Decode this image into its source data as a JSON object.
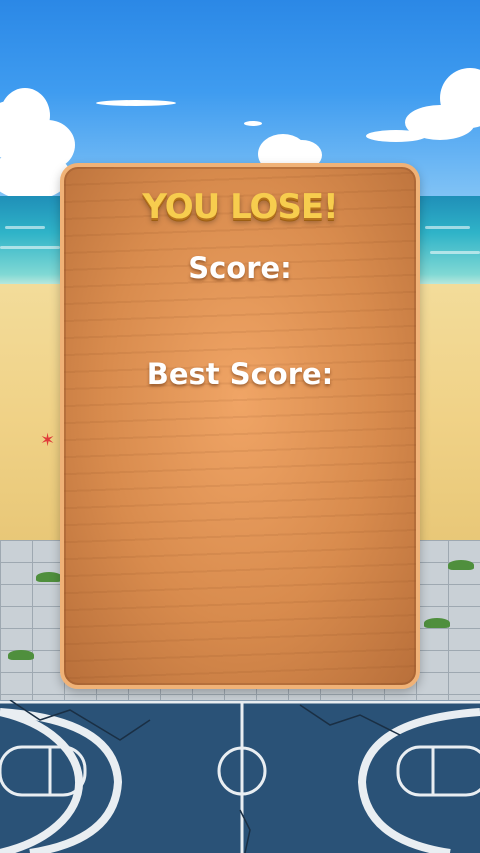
{
  "dialog": {
    "title": "YOU LOSE!",
    "score_label": "Score:",
    "best_score_label": "Best Score:"
  },
  "colors": {
    "title": "#f7cd4e",
    "board": "#d88b4d",
    "board_border": "#f0b277",
    "court": "#2a5277",
    "sky": "#3f9cf0"
  }
}
